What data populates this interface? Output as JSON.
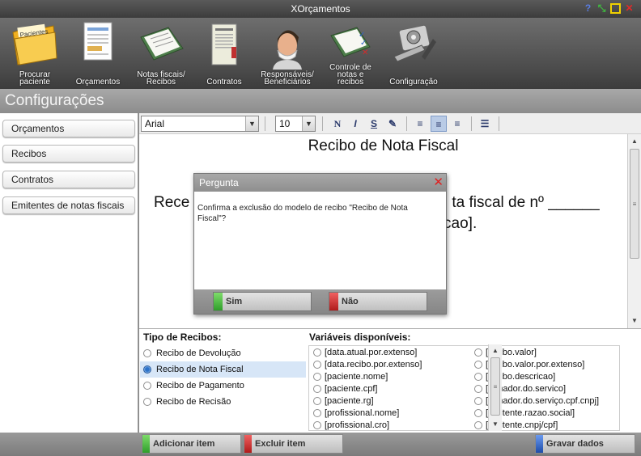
{
  "window": {
    "title": "XOrçamentos"
  },
  "toolbar": {
    "items": [
      {
        "label_line1": "Procurar",
        "label_line2": "paciente",
        "folder_tab": "Pacientes"
      },
      {
        "label_line1": "",
        "label_line2": "Orçamentos"
      },
      {
        "label_line1": "Notas fiscais/",
        "label_line2": "Recibos"
      },
      {
        "label_line1": "",
        "label_line2": "Contratos"
      },
      {
        "label_line1": "Responsáveis/",
        "label_line2": "Beneficiários"
      },
      {
        "label_line1": "Controle de",
        "label_line2": "notas e",
        "label_line3": "recibos"
      },
      {
        "label_line1": "",
        "label_line2": "Configuração"
      }
    ]
  },
  "section": {
    "title": "Configurações"
  },
  "sidebar": {
    "items": [
      "Orçamentos",
      "Recibos",
      "Contratos",
      "Emitentes de notas fiscais"
    ]
  },
  "editor": {
    "font": "Arial",
    "size": "10",
    "format_buttons": {
      "bold": "N",
      "italic": "I",
      "underline": "S"
    }
  },
  "document": {
    "title": "Recibo de Nota Fiscal",
    "body_left": "Rece",
    "body_right": "ta fiscal de nº ______",
    "body_line2": "cricao]."
  },
  "tipos": {
    "header": "Tipo de Recibos:",
    "items": [
      "Recibo de Devolução",
      "Recibo de Nota Fiscal",
      "Recibo de Pagamento",
      "Recibo de Recisão"
    ],
    "selected": "Recibo de Nota Fiscal"
  },
  "variables": {
    "header": "Variáveis disponíveis:",
    "left": [
      "[data.atual.por.extenso]",
      "[data.recibo.por.extenso]",
      "[paciente.nome]",
      "[paciente.cpf]",
      "[paciente.rg]",
      "[profissional.nome]",
      "[profissional.cro]"
    ],
    "right": [
      "[recibo.valor]",
      "[recibo.valor.por.extenso]",
      "[recibo.descricao]",
      "[tomador.do.servico]",
      "[tomador.do.serviço.cpf.cnpj]",
      "[emitente.razao.social]",
      "[emitente.cnpj/cpf]"
    ]
  },
  "actions": {
    "add": "Adicionar item",
    "delete": "Excluir item",
    "save": "Gravar dados"
  },
  "dialog": {
    "title": "Pergunta",
    "message": "Confirma a exclusão do modelo de recibo \"Recibo de Nota Fiscal\"?",
    "yes": "Sim",
    "no": "Não"
  },
  "colors": {
    "green": "#3cb43c",
    "red": "#d42a2a",
    "blue": "#2f63c7"
  }
}
